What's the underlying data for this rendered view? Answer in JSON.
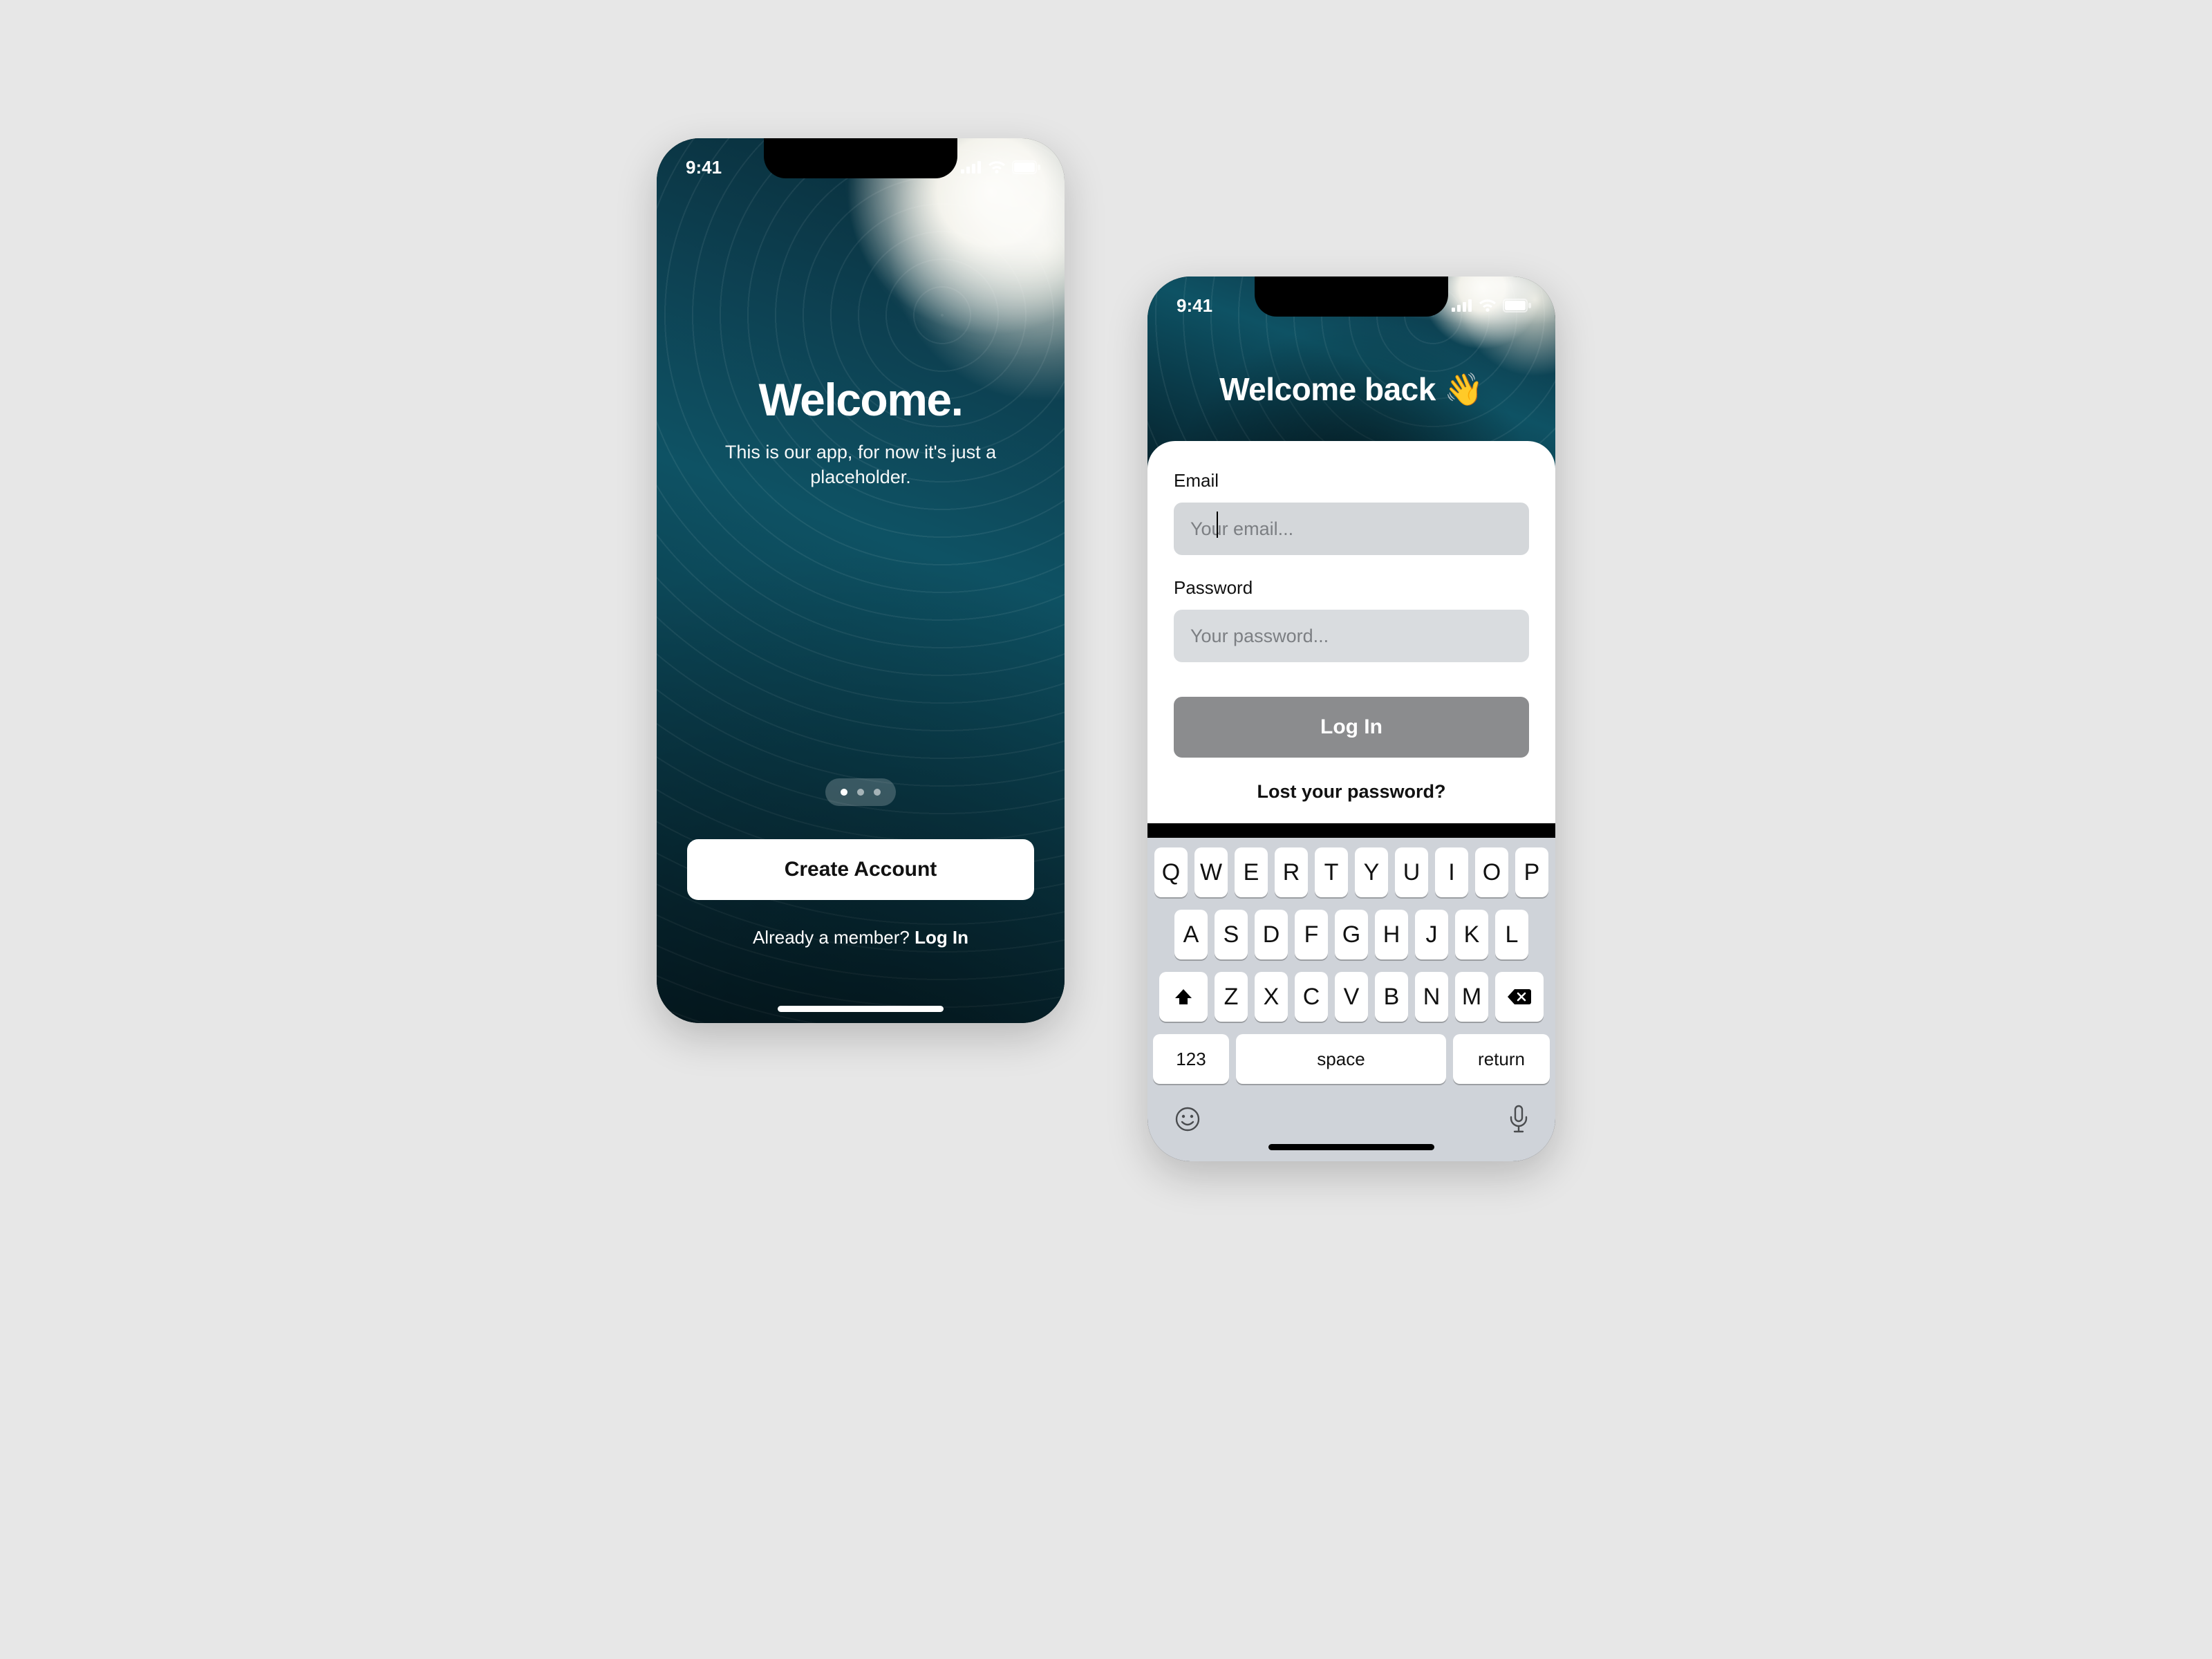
{
  "status": {
    "time": "9:41"
  },
  "welcome": {
    "title": "Welcome.",
    "subtitle": "This is our app, for now it's just a placeholder.",
    "pager": {
      "count": 3,
      "active_index": 0
    },
    "create_account_label": "Create Account",
    "member_question": "Already a member? ",
    "login_link": "Log In"
  },
  "login": {
    "title": "Welcome back 👋",
    "email_label": "Email",
    "email_placeholder": "Your email...",
    "password_label": "Password",
    "password_placeholder": "Your password...",
    "login_button": "Log In",
    "lost_password": "Lost your password?"
  },
  "keyboard": {
    "row1": [
      "Q",
      "W",
      "E",
      "R",
      "T",
      "Y",
      "U",
      "I",
      "O",
      "P"
    ],
    "row2": [
      "A",
      "S",
      "D",
      "F",
      "G",
      "H",
      "J",
      "K",
      "L"
    ],
    "row3": [
      "Z",
      "X",
      "C",
      "V",
      "B",
      "N",
      "M"
    ],
    "k123": "123",
    "space": "space",
    "return": "return"
  }
}
